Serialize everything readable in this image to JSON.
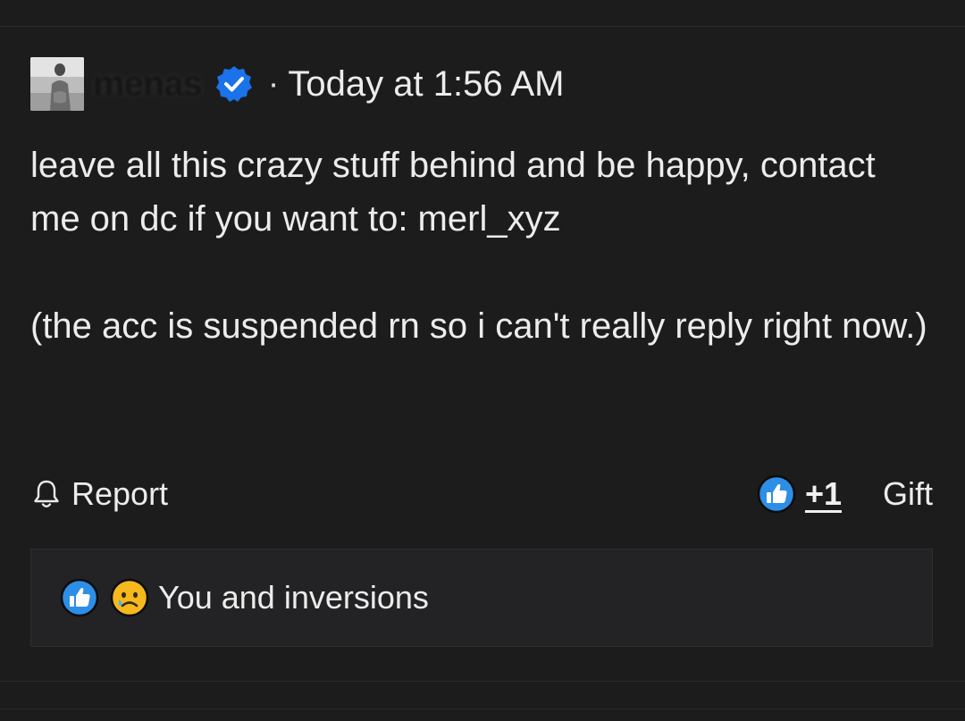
{
  "post": {
    "username": "menas",
    "meta_separator": "·",
    "timestamp": "Today at 1:56 AM",
    "paragraphs": [
      "leave all this crazy stuff behind and be happy, contact me on dc if you want to: merl_xyz",
      "(the acc is suspended rn so i can't really reply right now.)"
    ]
  },
  "actions": {
    "report_label": "Report",
    "like_count": "+1",
    "gift_label": "Gift"
  },
  "reactions": {
    "summary": "You and inversions",
    "icons": [
      "thumbs-up-icon",
      "sad-face-icon"
    ]
  },
  "colors": {
    "background": "#1c1c1d",
    "text": "#ececec",
    "verified_blue": "#1a73e8",
    "like_blue": "#2d8ee6",
    "sad_yellow": "#f5b91e"
  }
}
